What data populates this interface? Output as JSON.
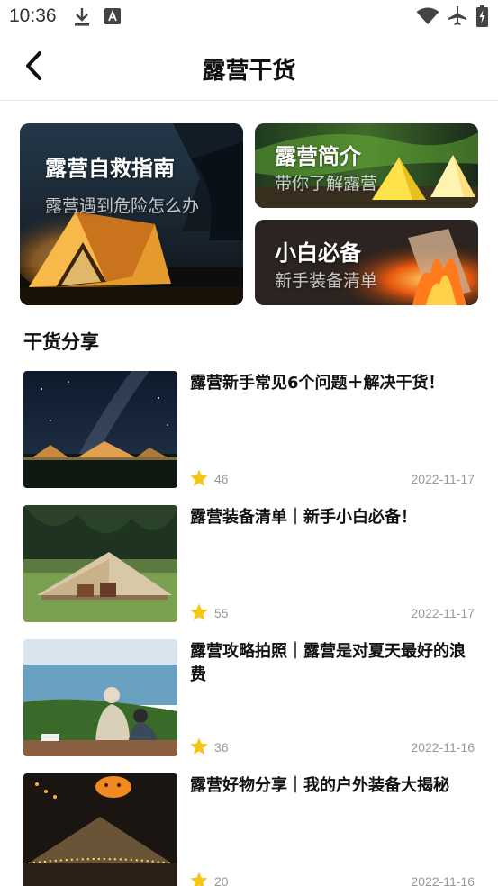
{
  "status_bar": {
    "time": "10:36",
    "left_icons": [
      "download-icon",
      "translate-icon"
    ],
    "right_icons": [
      "wifi-icon",
      "airplane-icon",
      "battery-icon"
    ]
  },
  "header": {
    "back_icon": "chevron-left-icon",
    "title": "露营干货"
  },
  "cards": {
    "main": {
      "title": "露营自救指南",
      "subtitle": "露营遇到危险怎么办"
    },
    "intro": {
      "title": "露营简介",
      "subtitle": "带你了解露营"
    },
    "novice": {
      "title": "小白必备",
      "subtitle": "新手装备清单"
    }
  },
  "section": {
    "title": "干货分享"
  },
  "articles": [
    {
      "title": "露营新手常见6个问题＋解决干货！",
      "likes": "46",
      "date": "2022-11-17",
      "icon": "star-icon"
    },
    {
      "title": "露营装备清单｜新手小白必备！",
      "likes": "55",
      "date": "2022-11-17",
      "icon": "star-icon"
    },
    {
      "title": "露营攻略拍照｜露营是对夏天最好的浪费",
      "likes": "36",
      "date": "2022-11-16",
      "icon": "star-icon"
    },
    {
      "title": "露营好物分享｜我的户外装备大揭秘",
      "likes": "20",
      "date": "2022-11-16",
      "icon": "star-icon"
    }
  ],
  "colors": {
    "star": "#f5c518",
    "meta_text": "#999999",
    "divider": "#e6e6e6"
  }
}
